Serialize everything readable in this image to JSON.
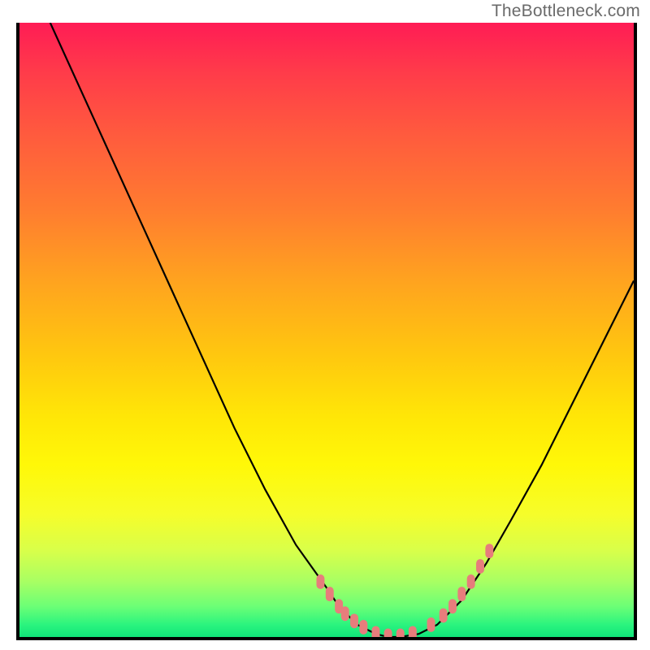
{
  "attribution": "TheBottleneck.com",
  "chart_data": {
    "type": "line",
    "title": "",
    "xlabel": "",
    "ylabel": "",
    "xlim": [
      0,
      100
    ],
    "ylim": [
      0,
      100
    ],
    "series": [
      {
        "name": "bottleneck-curve",
        "x": [
          5,
          10,
          15,
          20,
          25,
          30,
          35,
          40,
          45,
          50,
          52,
          55,
          58,
          60,
          62,
          65,
          68,
          72,
          76,
          80,
          85,
          90,
          95,
          100
        ],
        "y": [
          100,
          89,
          78,
          67,
          56,
          45,
          34,
          24,
          15,
          8,
          5,
          2,
          0.5,
          0,
          0,
          0.5,
          2,
          6,
          12,
          19,
          28,
          38,
          48,
          58
        ]
      }
    ],
    "markers": {
      "name": "highlighted-points",
      "color": "#e77d7c",
      "x": [
        49,
        50.5,
        52,
        53,
        54.5,
        56,
        58,
        60,
        62,
        64,
        67,
        69,
        70.5,
        72,
        73.5,
        75,
        76.5
      ],
      "y": [
        9,
        7,
        5,
        3.8,
        2.6,
        1.6,
        0.6,
        0.2,
        0.2,
        0.6,
        2,
        3.5,
        5,
        7,
        9,
        11.5,
        14
      ]
    },
    "gradient_stops": [
      {
        "pos": 0,
        "color": "#ff1c55"
      },
      {
        "pos": 18,
        "color": "#ff5a3e"
      },
      {
        "pos": 42,
        "color": "#ffa31f"
      },
      {
        "pos": 64,
        "color": "#ffe607"
      },
      {
        "pos": 86,
        "color": "#d8ff4a"
      },
      {
        "pos": 100,
        "color": "#10e47a"
      }
    ]
  }
}
